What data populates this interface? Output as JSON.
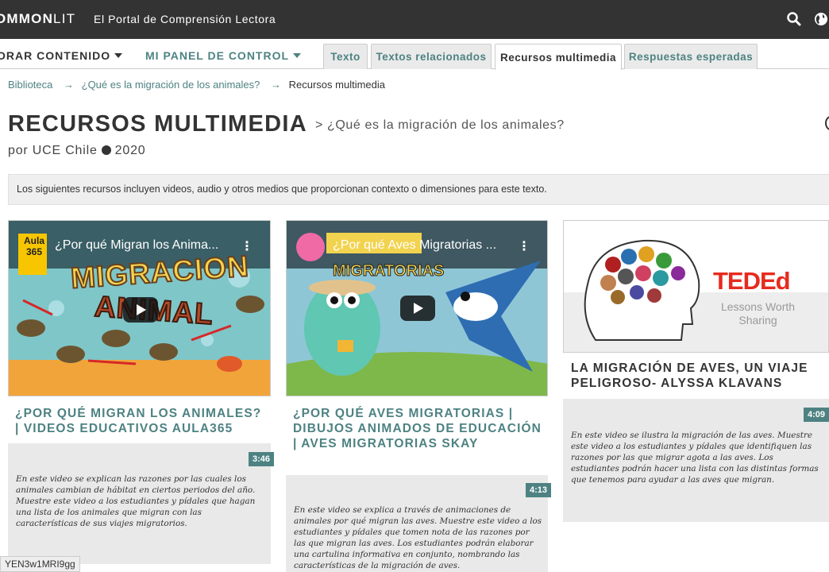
{
  "header": {
    "logo_bold": "OMMON",
    "logo_light": "LIT",
    "tagline": "El Portal de Comprensión Lectora"
  },
  "nav": {
    "explore": "ORAR CONTENIDO",
    "dashboard": "MI PANEL DE CONTROL",
    "tabs": [
      {
        "label": "Texto"
      },
      {
        "label": "Textos relacionados"
      },
      {
        "label": "Recursos multimedia"
      },
      {
        "label": "Respuestas esperadas"
      }
    ]
  },
  "breadcrumb": {
    "library": "Biblioteca",
    "text": "¿Qué es la migración de los animales?",
    "current": "Recursos multimedia"
  },
  "page": {
    "title": "RECURSOS MULTIMEDIA",
    "subtitle": "> ¿Qué es la migración de los animales?",
    "author": "por UCE Chile",
    "year": "2020",
    "info": "Los siguientes recursos incluyen videos, audio y otros medios que proporcionan contexto o dimensiones para este texto."
  },
  "cards": [
    {
      "video_title": "¿Por qué Migran los Anima...",
      "channel_badge": "Aula 365",
      "thumb_text_1": "MIGRACION",
      "thumb_text_2": "ANIMAL",
      "title": "¿POR QUÉ MIGRAN LOS ANIMALES? | VIDEOS EDUCATIVOS AULA365",
      "duration": "3:46",
      "description": "En este video se explican las razones por las cuales los animales cambian de hábitat en ciertos periodos del año. Muestre este video a los estudiantes y pídales que hagan una lista de los animales que migran con las características de sus viajes migratorios."
    },
    {
      "video_title": "¿Por qué Aves Migratorias ...",
      "thumb_text_1": "MIGRATORIAS",
      "title": "¿POR QUÉ AVES MIGRATORIAS | DIBUJOS ANIMADOS DE EDUCACIÓN | AVES MIGRATORIAS SKAY",
      "duration": "4:13",
      "description": "En este video se explica a través de animaciones de animales por qué migran las aves. Muestre este video a los estudiantes y pídales que tomen nota de las razones por las que migran las aves. Los estudiantes podrán elaborar una cartulina informativa en conjunto, nombrando las características de la migración de aves."
    },
    {
      "brand": "TEDEd",
      "brand_tagline_1": "Lessons Worth",
      "brand_tagline_2": "Sharing",
      "title": "LA MIGRACIÓN DE AVES, UN VIAJE PELIGROSO- ALYSSA KLAVANS",
      "duration": "4:09",
      "description": "En este video se ilustra la migración de las aves. Muestre este video a los estudiantes y pídales que identifiquen las razones por las que migrar agota a las aves. Los estudiantes podrán hacer una lista con las distintas formas que tenemos para ayudar a las aves que migran."
    }
  ],
  "status_tip": "YEN3w1MRI9gg",
  "colors": {
    "accent": "#4e8282",
    "topbar": "#333333",
    "panel": "#e9e9e9"
  }
}
